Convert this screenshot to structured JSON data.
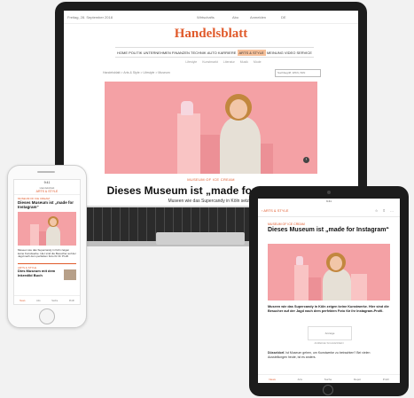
{
  "site": {
    "brand": "Handelsblatt",
    "accent_color": "#e05a2b",
    "hero_color": "#f4a1a5",
    "date": "Freitag, 28. September 2018",
    "topbar_links": [
      "Wirtschafts",
      "Abo",
      "Anmelden",
      "DE"
    ],
    "nav": [
      "HOME",
      "POLITIK",
      "UNTERNEHMEN",
      "FINANZEN",
      "TECHNIK",
      "AUTO",
      "KARRIERE",
      "ARTS & STYLE",
      "MEINUNG",
      "VIDEO",
      "SERVICE"
    ],
    "nav_active_index": 7,
    "subnav": [
      "Lifestyle",
      "Kunstmarkt",
      "Literatur",
      "Musik",
      "Mode"
    ],
    "breadcrumb": "Handelsblatt > Arts & Style > Lifestyle > Museum",
    "search_placeholder": "Suchbegriff, WKN, ISIN"
  },
  "article": {
    "kicker": "MUSEUM OF ICE CREAM",
    "headline": "Dieses Museum ist „made for Instagram“",
    "subline": "Museen wie das Supercandy in Köln setzen",
    "teaser": "Museen wie das Supercandy in Köln zeigen keine Kunstwerke. Hier sind die Besucher auf der Jagd nach dem perfekten Foto für ihr Instagram-Profil.",
    "body_lead": "Düsseldorf.",
    "body": "Ist Museum gehen, um Kunstwerke zu betrachten? Bei vielen Ausstellungen heute, ist es anders."
  },
  "phone": {
    "time": "9:41",
    "section_kicker": "Handelsblatt",
    "section": "ARTS & STYLE",
    "kicker": "MUSEUM OF ICE CREAM",
    "headline": "Dieses Museum ist „made for Instagram“",
    "teaser": "Museen wie das Supercandy in Köln zeigen keine Kunstwerke. Hier sind die Besucher auf der Jagd nach dem perfekten Foto für ihr Profil.",
    "second_kicker": "ARTS & STYLE",
    "second_headline": "Dies Museum mit dem Inkredibl Buch",
    "tabs": [
      "News",
      "Arts",
      "Suche",
      "Profil"
    ]
  },
  "tablet": {
    "time": "9:41",
    "back_label": "‹ ARTS & STYLE",
    "nav_icons": "☆ ⇧ …",
    "kicker": "MUSEUM OF ICE CREAM",
    "headline": "Dieses Museum ist „made for Instagram“",
    "teaser": "Museen wie das Supercandy in Köln zeigen keine Kunstwerke. Hier sind die Besucher auf der Jagd nach dem perfekten Foto für ihr Instagram-Profil.",
    "ad_label": "Anzeige",
    "ad_caption": "ANZEIGE SCHLIESSEN",
    "tabs": [
      "News",
      "Arts",
      "Suche",
      "Depot",
      "Profil"
    ]
  }
}
